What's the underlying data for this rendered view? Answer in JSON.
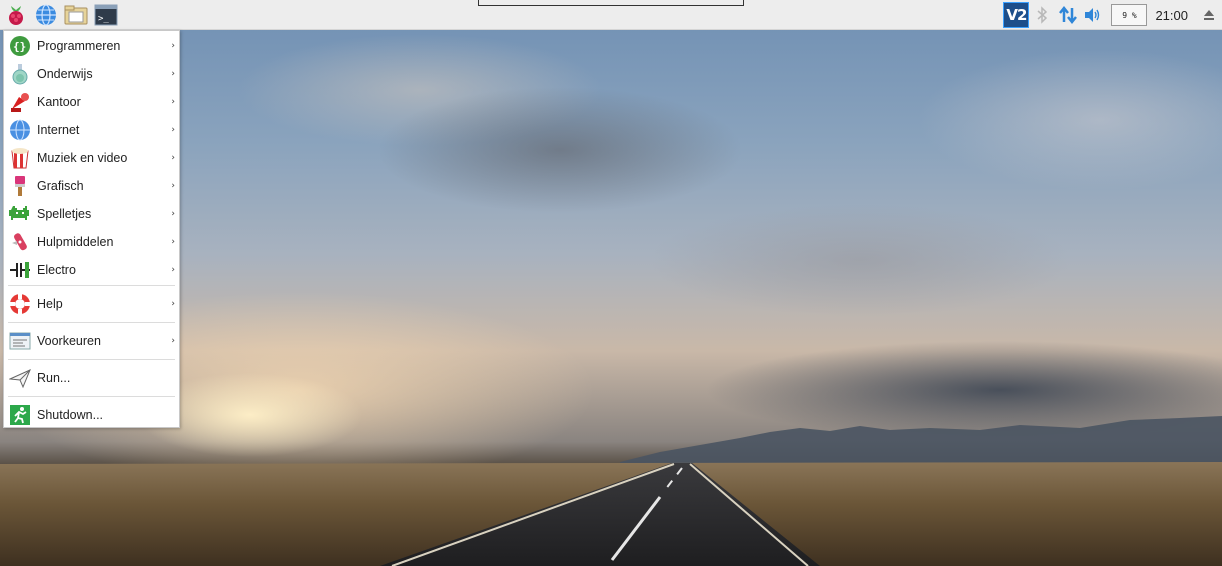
{
  "panel": {
    "launchers": [
      {
        "name": "raspberry-menu",
        "icon": "raspberry-icon"
      },
      {
        "name": "web-browser",
        "icon": "globe-icon"
      },
      {
        "name": "file-manager",
        "icon": "folder-icon"
      },
      {
        "name": "terminal",
        "icon": "terminal-icon"
      }
    ],
    "tray": {
      "vnc_label": "V2",
      "bluetooth_icon": "bluetooth-icon",
      "network_icon": "network-updown-icon",
      "volume_icon": "volume-icon",
      "cpu_label": "9 %",
      "clock": "21:00",
      "eject_icon": "eject-icon"
    }
  },
  "menu": {
    "items": [
      {
        "label": "Programmeren",
        "icon": "programming-icon",
        "submenu": true
      },
      {
        "label": "Onderwijs",
        "icon": "education-icon",
        "submenu": true
      },
      {
        "label": "Kantoor",
        "icon": "office-icon",
        "submenu": true
      },
      {
        "label": "Internet",
        "icon": "internet-icon",
        "submenu": true
      },
      {
        "label": "Muziek en video",
        "icon": "music-video-icon",
        "submenu": true
      },
      {
        "label": "Grafisch",
        "icon": "graphics-icon",
        "submenu": true
      },
      {
        "label": "Spelletjes",
        "icon": "games-icon",
        "submenu": true
      },
      {
        "label": "Hulpmiddelen",
        "icon": "accessories-icon",
        "submenu": true
      },
      {
        "label": "Electro",
        "icon": "electronics-icon",
        "submenu": true
      }
    ],
    "help": {
      "label": "Help",
      "icon": "help-icon",
      "submenu": true
    },
    "preferences": {
      "label": "Voorkeuren",
      "icon": "preferences-icon",
      "submenu": true
    },
    "run": {
      "label": "Run...",
      "icon": "run-icon"
    },
    "shutdown": {
      "label": "Shutdown...",
      "icon": "shutdown-icon"
    },
    "arrow_glyph": "›"
  },
  "colors": {
    "panel_bg": "#ededed",
    "menu_bg": "#ffffff",
    "vnc_bg": "#1d4e8a",
    "accent_blue": "#2f86d8"
  }
}
